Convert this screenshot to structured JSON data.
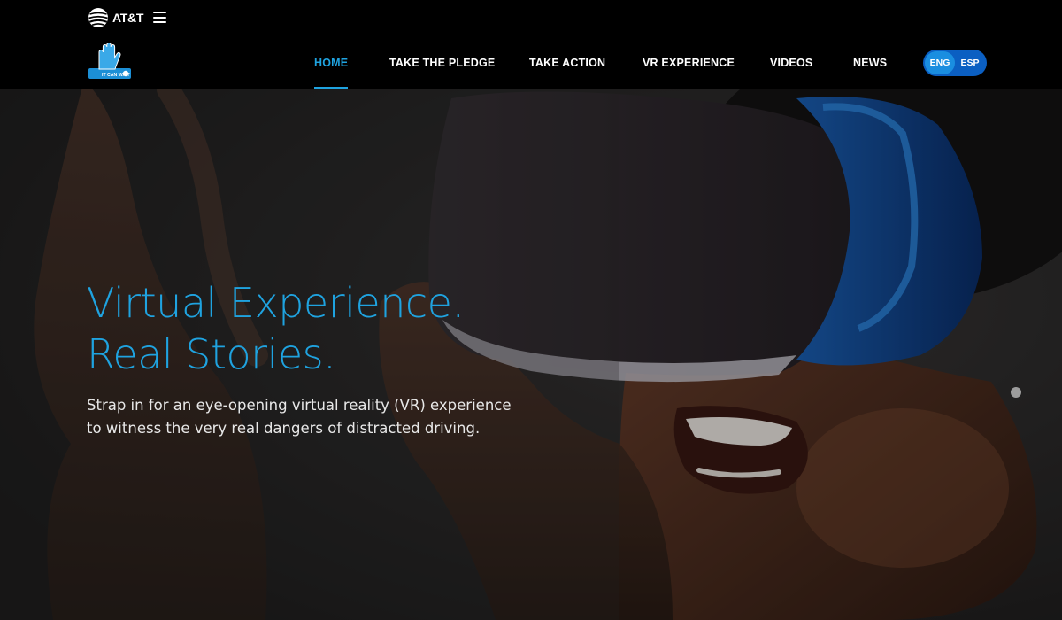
{
  "util_bar": {
    "brand_text": "AT&T",
    "menu_icon": "hamburger-icon"
  },
  "nav": {
    "logo_icon": "it-can-wait-hand-badge",
    "logo_text": "IT CAN WAIT",
    "items": [
      {
        "label": "HOME",
        "active": true
      },
      {
        "label": "TAKE THE PLEDGE",
        "active": false
      },
      {
        "label": "TAKE ACTION",
        "active": false
      },
      {
        "label": "VR EXPERIENCE",
        "active": false
      },
      {
        "label": "VIDEOS",
        "active": false
      },
      {
        "label": "NEWS",
        "active": false
      }
    ],
    "languages": [
      {
        "label": "ENG",
        "active": true
      },
      {
        "label": "ESP",
        "active": false
      }
    ]
  },
  "hero": {
    "title_line1": "Virtual Experience.",
    "title_line2": "Real Stories.",
    "subtitle": "Strap in for an eye-opening virtual reality (VR) experience to witness the very real dangers of distracted driving.",
    "image": "woman-wearing-vr-headset-photo"
  },
  "colors": {
    "accent": "#1fa3e0",
    "toggle_bg": "#0b5fc2",
    "bar_bg": "#000000"
  }
}
